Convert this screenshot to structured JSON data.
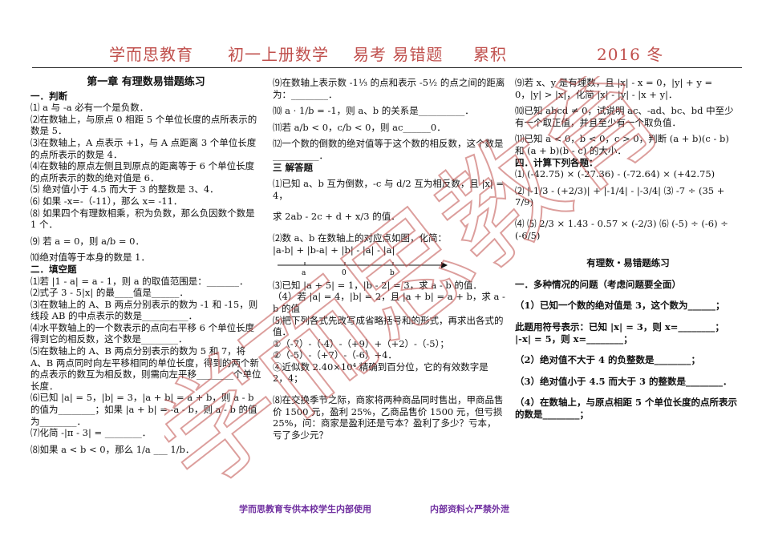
{
  "header": {
    "org": "学而思教育",
    "course": "初一上册数学",
    "topic": "易考  易错题",
    "tag": "累积",
    "term": "2016 冬"
  },
  "watermark": {
    "text": "学而思教育",
    "color": "#c0504d"
  },
  "col1": [
    "第一章  有理数易错题练习",
    "一．判断",
    "⑴ a 与 -a 必有一个是负数．",
    "⑵在数轴上，与原点 0 相距 5 个单位长度的点所表示的数是 5．",
    "⑶在数轴上，A 点表示 +1，与 A 点距离 3 个单位长度的点所表示的数是 4．",
    "⑷在数轴的原点左侧且到原点的距离等于 6 个单位长度的点所表示的数的绝对值是 6．",
    "⑸  绝对值小于 4.5 而大于 3 的整数是 3、4．",
    "⑹  如果 -x=-（-11），那么 x= -11．",
    "⑻  如果四个有理数相乘，积为负数，那么负因数个数是 1 个．",
    "⑼  若 a = 0，则 a/b = 0．",
    "⑽绝对值等于本身的数是 1．",
    "二．填空题",
    "⑴若 |1 - a| = a - 1，则 a 的取值范围是：_______．",
    "⑵式子 3 - 5|x| 的最____值是______．",
    "⑶在数轴上的 A、B 两点分别表示的数为 -1 和 -15，则线段 AB 的中点表示的数是__________．",
    "⑷水平数轴上的一个数表示的点向右平移 6 个单位长度得到它的相反数，这个数是________．",
    "⑸在数轴上的 A、B 两点分别表示的数为 5 和 7，将 A、B 两点同时向左平移相同的单位长度，得到的两个新的点表示的数互为相反数，则需向左平移________个单位长度．",
    "⑹已知 |a| = 5，|b| = 3，|a + b| = a + b，则 a - b 的值为________；如果 |a + b| = -a - b，则 a - b 的值为________．",
    "⑺化简 -|π - 3| = ________．",
    "⑻如果 a < b < 0，那么 1/a ___ 1/b．"
  ],
  "col2": [
    "⑼在数轴上表示数 -1⅓ 的点和表示 -5½ 的点之间的距离为：________．",
    "⑽ a · 1/b = -1，则 a、b 的关系是__________．",
    "⑾若 a/b < 0，c/b < 0，则 ac______0．",
    "⑿一个数的倒数的绝对值等于这个数的相反数，这个数是__________．",
    "三 解答题",
    "⑴已知 a、b 互为倒数，-c 与 d/2 互为相反数，且 |x| = 4，",
    "求 2ab - 2c + d + x/3 的值．",
    "⑵数 a、b 在数轴上的对应点如图，化简：",
    "|a-b| + |b-a| + |b| - |a| - |a|",
    "⑶已知 |a + 5| = 1，|b - 2| = 3，求 a - b 的值．",
    "（4）若 |a| = 4，|b| = 2，且 |a + b| = a + b，求 a - b 的值",
    "⑸把下列各式先改写成省略括号和的形式，再求出各式的值．",
    "①（-7）-（-4）-（+9）+（+2）-（-5）；",
    "②（-5）-（+7）-（-6）+4．",
    "④近似数 2.40×10⁴ 精确到百分位，它的有效数字是 2，4；",
    "⑻在交换季节之际，商家将两种商品同时售出，甲商品售价 1500 元，盈利 25%，乙商品售价 1500 元，但亏损 25%，问：商家是盈利还是亏本？盈利了多少？亏本，亏了多少元？"
  ],
  "col3": [
    "⑼若 x、y 是有理数，且 |x| - x = 0，|y| + y = 0，|y| > |x|，化简 |x| - |y| - |x + y|．",
    "⑽已知 abcd ≠ 0，试说明 ac、-ad、bc、bd 中至少有一个取正值，并且至少有一个取负值．",
    "⑾已知 a < 0，b < 0，c > 0，判断 (a + b)(c - b) 和 (a + b)(b - c) 的大小．",
    "四．计算下列各题：",
    "⑴ (-42.75) × (-27.36) - (-72.64) × (+42.75)",
    "⑵ |-1/3 - (+2/3)| + |-1/4| - |-3/4|     ⑶ -7 ÷ (35 + 7/9)",
    "⑷  ⑸ 2/3 × 1.43 - 0.57 × (-2/3)   ⑹ (-5) ÷ (-6) ÷ (-6/5)",
    "有理数・易错题练习",
    "一．多种情况的问题（考虑问题要全面）",
    "（1）已知一个数的绝对值是 3，这个数为______；",
    "此题用符号表示：已知 |x| = 3，则 x=________；",
    "|-x| = 5，则 x=________；",
    "（2）绝对值不大于 4 的负整数是________；",
    "（3）绝对值小于 4.5 而大于 3 的整数是________．",
    "（4）在数轴上，与原点相距 5 个单位长度的点所表示的数是________；"
  ],
  "footer": {
    "left": "学而思教育专供本校学生内部使用",
    "right": "内部资料☆严禁外泄"
  }
}
